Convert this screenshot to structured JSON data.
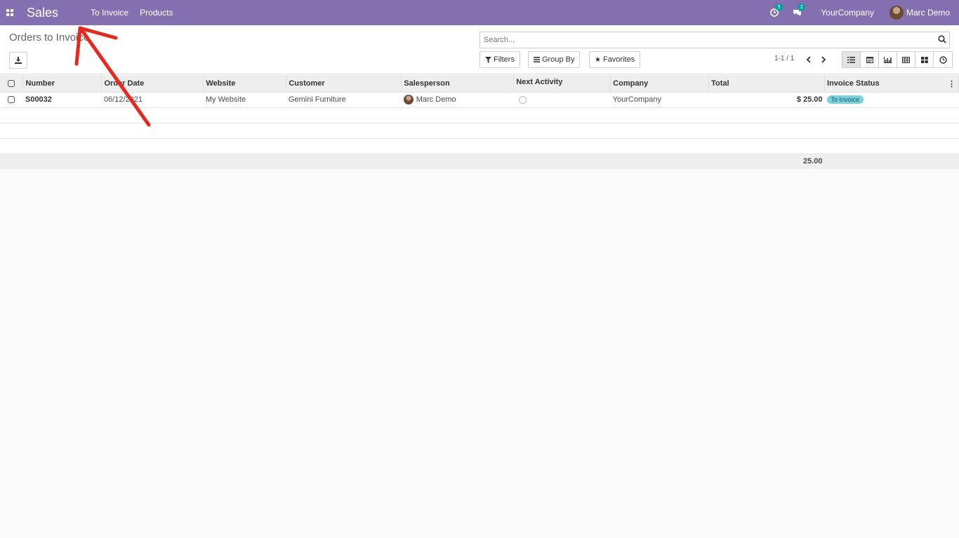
{
  "navbar": {
    "app_title": "Sales",
    "menu": [
      "To Invoice",
      "Products"
    ],
    "activity_count": "5",
    "messages_count": "2",
    "company": "YourCompany",
    "user": "Marc Demo"
  },
  "control_panel": {
    "breadcrumb": "Orders to Invoice",
    "search_placeholder": "Search...",
    "filters_label": "Filters",
    "group_by_label": "Group By",
    "favorites_label": "Favorites",
    "pager": "1-1 / 1"
  },
  "table": {
    "columns": [
      "Number",
      "Order Date",
      "Website",
      "Customer",
      "Salesperson",
      "Next Activity",
      "Company",
      "Total",
      "Invoice Status"
    ],
    "rows": [
      {
        "number": "S00032",
        "order_date": "06/12/2021",
        "website": "My Website",
        "customer": "Gemini Furniture",
        "salesperson": "Marc Demo",
        "company": "YourCompany",
        "total": "$ 25.00",
        "invoice_status": "To Invoice"
      }
    ],
    "footer_total": "25.00"
  },
  "colors": {
    "navbar": "#8470b1",
    "badge": "#00a09d",
    "status_badge": "#79d1e0",
    "annotation_arrow": "#e8281c"
  }
}
